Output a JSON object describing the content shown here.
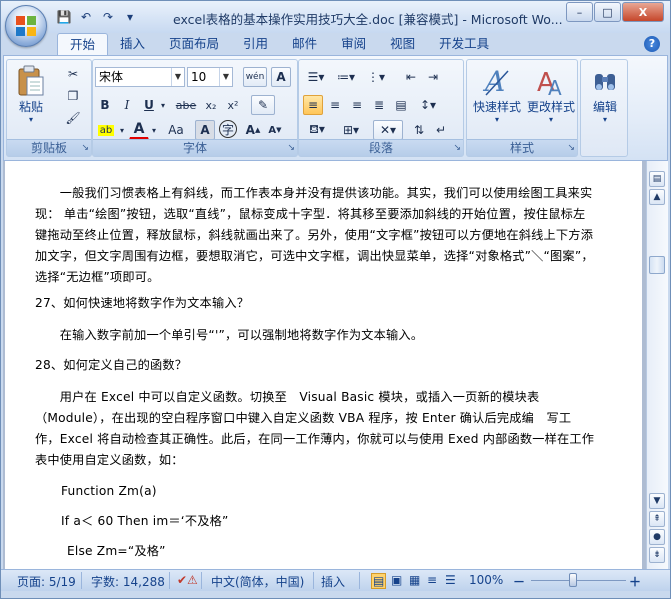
{
  "window": {
    "title": "excel表格的基本操作实用技巧大全.doc [兼容模式] - Microsoft Wo...",
    "controls": {
      "minimize": "–",
      "maximize": "□",
      "close": "X"
    }
  },
  "qat": {
    "save": "💾",
    "undo": "↶",
    "redo": "↷",
    "customize": "▾"
  },
  "tabs": [
    {
      "label": "开始",
      "active": true
    },
    {
      "label": "插入"
    },
    {
      "label": "页面布局"
    },
    {
      "label": "引用"
    },
    {
      "label": "邮件"
    },
    {
      "label": "审阅"
    },
    {
      "label": "视图"
    },
    {
      "label": "开发工具"
    }
  ],
  "ribbon": {
    "clipboard": {
      "label": "剪贴板",
      "paste": "粘贴"
    },
    "font": {
      "label": "字体",
      "font_name": "宋体",
      "font_size": "10",
      "wen": "wén",
      "A": "A",
      "bold": "B",
      "italic": "I",
      "underline": "U",
      "strike": "abe",
      "sub": "x₂",
      "sup": "x²",
      "Aa": "Aa",
      "zi": "字"
    },
    "paragraph": {
      "label": "段落"
    },
    "styles": {
      "label": "样式",
      "quick": "快速样式",
      "change": "更改样式"
    },
    "editing": {
      "label": "编辑"
    }
  },
  "document": {
    "paragraphs": [
      "　　一般我们习惯表格上有斜线，而工作表本身并没有提供该功能。其实，我们可以使用绘图工具来实现： 单击“绘图”按钮，选取“直线”，鼠标变成十字型．将其移至要添加斜线的开始位置，按住鼠标左键拖动至终止位置，释放鼠标，斜线就画出来了。另外，使用“文字框”按钮可以方便地在斜线上下方添加文字，但文字周围有边框，要想取消它，可选中文字框，调出快显菜单，选择“对象格式”＼“图案”，选择“无边框”项即可。",
      "27、如何快速地将数字作为文本输入？",
      "　　在输入数字前加一个单引号“'”，可以强制地将数字作为文本输入。",
      "28、如何定义自己的函数？",
      "　　用户在 Excel 中可以自定义函数。切换至　Visual Basic 模块，或插入一页新的模块表（Module），在出现的空白程序窗口中键入自定义函数 VBA 程序，按 Enter 确认后完成编　写工作，Excel 将自动检查其正确性。此后，在同一工作薄内，你就可以与使用 Exed 内部函数一样在工作表中使用自定义函数，如：",
      "Function Zm(a)",
      "If a＜ 60 Then im＝‘不及格”",
      "Else Zm=“及格”"
    ]
  },
  "status": {
    "page": "页面: 5/19",
    "words": "字数: 14,288",
    "language": "中文(简体，中国)",
    "mode": "插入",
    "zoom": "100%",
    "zoom_minus": "－",
    "zoom_plus": "＋"
  }
}
